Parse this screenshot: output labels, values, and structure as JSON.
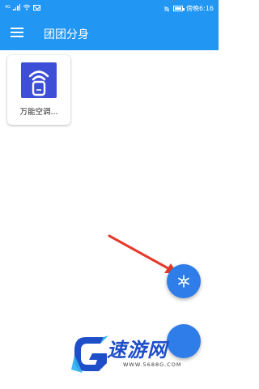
{
  "status_bar": {
    "time": "傍晚6:16",
    "signal_label": "4G"
  },
  "app_bar": {
    "title": "团团分身"
  },
  "apps": [
    {
      "label": "万能空调..."
    }
  ],
  "watermark": {
    "brand": "速游网",
    "url": "WWW.5688G.COM"
  },
  "colors": {
    "primary": "#2196f3",
    "fab": "#2f7de8",
    "app_icon": "#3d4fd6",
    "annotation_arrow": "#e53a2c",
    "watermark": "#1e4fc9"
  },
  "icons": {
    "menu": "menu-icon",
    "fab_main": "snowflake-settings-icon",
    "app": "wifi-remote-icon"
  }
}
